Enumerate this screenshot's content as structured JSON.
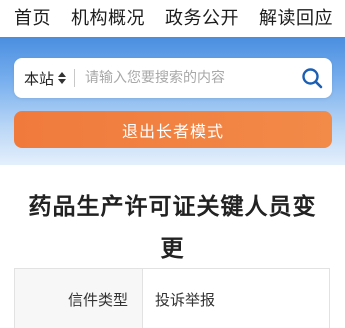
{
  "nav": {
    "items": [
      {
        "label": "首页"
      },
      {
        "label": "机构概况"
      },
      {
        "label": "政务公开"
      },
      {
        "label": "解读回应"
      }
    ]
  },
  "search": {
    "scope_label": "本站",
    "placeholder": "请输入您要搜索的内容"
  },
  "elder_mode": {
    "label": "退出长者模式"
  },
  "article": {
    "title": "药品生产许可证关键人员变更"
  },
  "info_table": {
    "rows": [
      {
        "key": "信件类型",
        "value": "投诉举报"
      }
    ]
  },
  "colors": {
    "header_blue": "#4a8ee0",
    "elder_button_orange": "#f07a3c",
    "search_icon": "#1a5fb4"
  }
}
